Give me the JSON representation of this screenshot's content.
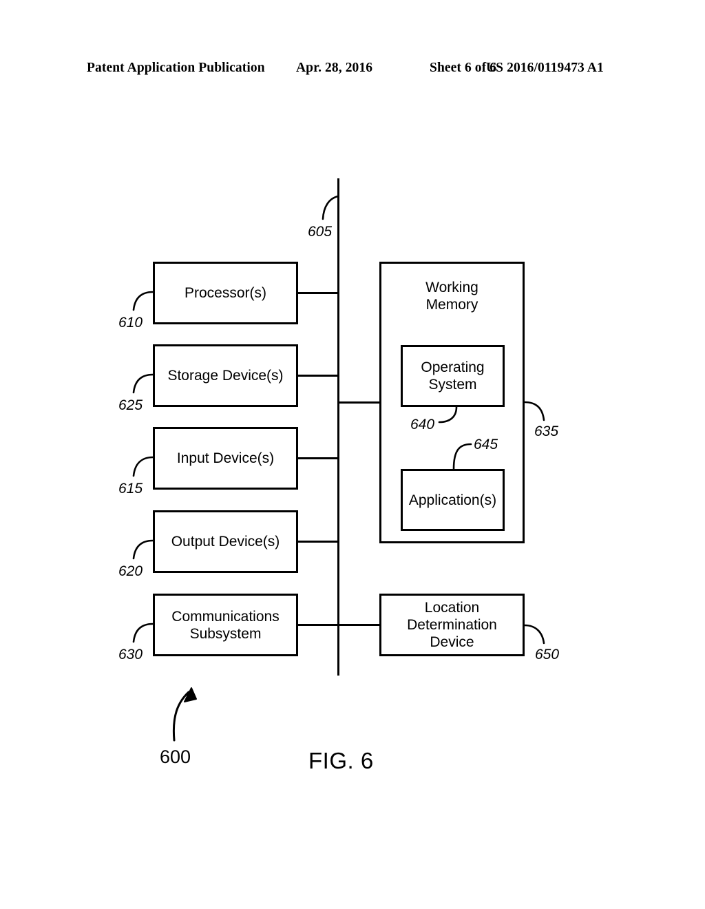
{
  "page_header": {
    "publication": "Patent Application Publication",
    "date": "Apr. 28, 2016",
    "sheet": "Sheet 6 of 6",
    "patent_number": "US 2016/0119473 A1"
  },
  "figure": {
    "caption": "FIG. 6",
    "system_ref": "600",
    "bus": {
      "name": "bus",
      "ref": "605"
    },
    "left_column": [
      {
        "label": "Processor(s)",
        "ref": "610"
      },
      {
        "label": "Storage Device(s)",
        "ref": "625"
      },
      {
        "label": "Input Device(s)",
        "ref": "615"
      },
      {
        "label": "Output Device(s)",
        "ref": "620"
      },
      {
        "label": "Communications\nSubsystem",
        "ref": "630",
        "line1": "Communications",
        "line2": "Subsystem"
      }
    ],
    "right_column": [
      {
        "label": "Working Memory",
        "ref": "635",
        "line1": "Working",
        "line2": "Memory",
        "children": [
          {
            "label": "Operating System",
            "ref": "640",
            "line1": "Operating",
            "line2": "System"
          },
          {
            "label": "Application(s)",
            "ref": "645"
          }
        ]
      },
      {
        "label": "Location Determination Device",
        "ref": "650",
        "line1": "Location",
        "line2": "Determination",
        "line3": "Device"
      }
    ]
  },
  "colors": {
    "ink": "#000000",
    "paper": "#ffffff"
  }
}
